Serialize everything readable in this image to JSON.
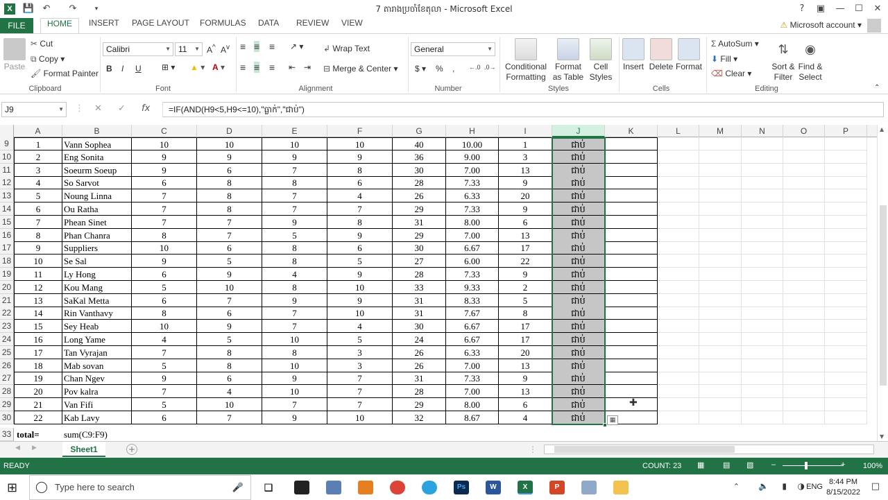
{
  "window": {
    "title": "7 តារាងប្រចាំខែតុលា - Microsoft Excel",
    "help": "?",
    "account_label": "Microsoft account"
  },
  "tabs": [
    "FILE",
    "HOME",
    "INSERT",
    "PAGE LAYOUT",
    "FORMULAS",
    "DATA",
    "REVIEW",
    "VIEW"
  ],
  "active_tab": "HOME",
  "ribbon": {
    "clipboard": {
      "label": "Clipboard",
      "paste": "Paste",
      "cut": "Cut",
      "copy": "Copy",
      "format_painter": "Format Painter"
    },
    "font": {
      "label": "Font",
      "name": "Calibri",
      "size": "11",
      "bold": "B",
      "italic": "I",
      "underline": "U"
    },
    "alignment": {
      "label": "Alignment",
      "wrap_text": "Wrap Text",
      "merge_center": "Merge & Center"
    },
    "number": {
      "label": "Number",
      "format": "General",
      "currency": "$",
      "percent": "%",
      "comma": ","
    },
    "styles": {
      "label": "Styles",
      "conditional": "Conditional Formatting",
      "format_table": "Format as Table",
      "cell_styles": "Cell Styles"
    },
    "cells": {
      "label": "Cells",
      "insert": "Insert",
      "delete": "Delete",
      "format": "Format"
    },
    "editing": {
      "label": "Editing",
      "autosum": "AutoSum",
      "fill": "Fill",
      "clear": "Clear",
      "sort_filter": "Sort & Filter",
      "find_select": "Find & Select"
    }
  },
  "formula_bar": {
    "name_box": "J9",
    "fx": "fx",
    "formula": "=IF(AND(H9<5,H9<=10),\"ធ្លាក់\",\"ជាប់\")"
  },
  "columns": [
    "A",
    "B",
    "C",
    "D",
    "E",
    "F",
    "G",
    "H",
    "I",
    "J",
    "K",
    "L",
    "M",
    "N",
    "O",
    "P"
  ],
  "selected_column": "J",
  "rows": [
    {
      "r": "9",
      "a": "1",
      "b": "Vann Sophea",
      "c": "10",
      "d": "10",
      "e": "10",
      "f": "10",
      "g": "40",
      "h": "10.00",
      "i": "1",
      "j": "ជាប់"
    },
    {
      "r": "10",
      "a": "2",
      "b": "Eng Sonita",
      "c": "9",
      "d": "9",
      "e": "9",
      "f": "9",
      "g": "36",
      "h": "9.00",
      "i": "3",
      "j": "ជាប់"
    },
    {
      "r": "11",
      "a": "3",
      "b": "Soeurm Soeup",
      "c": "9",
      "d": "6",
      "e": "7",
      "f": "8",
      "g": "30",
      "h": "7.00",
      "i": "13",
      "j": "ជាប់"
    },
    {
      "r": "12",
      "a": "4",
      "b": "So Sarvot",
      "c": "6",
      "d": "8",
      "e": "8",
      "f": "6",
      "g": "28",
      "h": "7.33",
      "i": "9",
      "j": "ជាប់"
    },
    {
      "r": "13",
      "a": "5",
      "b": "Noung Linna",
      "c": "7",
      "d": "8",
      "e": "7",
      "f": "4",
      "g": "26",
      "h": "6.33",
      "i": "20",
      "j": "ជាប់"
    },
    {
      "r": "14",
      "a": "6",
      "b": "Ou Ratha",
      "c": "7",
      "d": "8",
      "e": "7",
      "f": "7",
      "g": "29",
      "h": "7.33",
      "i": "9",
      "j": "ជាប់"
    },
    {
      "r": "15",
      "a": "7",
      "b": "Phean Sinet",
      "c": "7",
      "d": "7",
      "e": "9",
      "f": "8",
      "g": "31",
      "h": "8.00",
      "i": "6",
      "j": "ជាប់"
    },
    {
      "r": "16",
      "a": "8",
      "b": "Phan Chanra",
      "c": "8",
      "d": "7",
      "e": "5",
      "f": "9",
      "g": "29",
      "h": "7.00",
      "i": "13",
      "j": "ជាប់"
    },
    {
      "r": "17",
      "a": "9",
      "b": "Suppliers",
      "c": "10",
      "d": "6",
      "e": "8",
      "f": "6",
      "g": "30",
      "h": "6.67",
      "i": "17",
      "j": "ជាប់"
    },
    {
      "r": "18",
      "a": "10",
      "b": "Se Sal",
      "c": "9",
      "d": "5",
      "e": "8",
      "f": "5",
      "g": "27",
      "h": "6.00",
      "i": "22",
      "j": "ជាប់"
    },
    {
      "r": "19",
      "a": "11",
      "b": "Ly Hong",
      "c": "6",
      "d": "9",
      "e": "4",
      "f": "9",
      "g": "28",
      "h": "7.33",
      "i": "9",
      "j": "ជាប់"
    },
    {
      "r": "20",
      "a": "12",
      "b": "Kou Mang",
      "c": "5",
      "d": "10",
      "e": "8",
      "f": "10",
      "g": "33",
      "h": "9.33",
      "i": "2",
      "j": "ជាប់"
    },
    {
      "r": "21",
      "a": "13",
      "b": "SaKal Metta",
      "c": "6",
      "d": "7",
      "e": "9",
      "f": "9",
      "g": "31",
      "h": "8.33",
      "i": "5",
      "j": "ជាប់"
    },
    {
      "r": "22",
      "a": "14",
      "b": "Rin Vanthavy",
      "c": "8",
      "d": "6",
      "e": "7",
      "f": "10",
      "g": "31",
      "h": "7.67",
      "i": "8",
      "j": "ជាប់"
    },
    {
      "r": "23",
      "a": "15",
      "b": "Sey Heab",
      "c": "10",
      "d": "9",
      "e": "7",
      "f": "4",
      "g": "30",
      "h": "6.67",
      "i": "17",
      "j": "ជាប់"
    },
    {
      "r": "24",
      "a": "16",
      "b": "Long Yame",
      "c": "4",
      "d": "5",
      "e": "10",
      "f": "5",
      "g": "24",
      "h": "6.67",
      "i": "17",
      "j": "ជាប់"
    },
    {
      "r": "25",
      "a": "17",
      "b": "Tan Vyrajan",
      "c": "7",
      "d": "8",
      "e": "8",
      "f": "3",
      "g": "26",
      "h": "6.33",
      "i": "20",
      "j": "ជាប់"
    },
    {
      "r": "26",
      "a": "18",
      "b": "Mab sovan",
      "c": "5",
      "d": "8",
      "e": "10",
      "f": "3",
      "g": "26",
      "h": "7.00",
      "i": "13",
      "j": "ជាប់"
    },
    {
      "r": "27",
      "a": "19",
      "b": "Chan Ngev",
      "c": "9",
      "d": "6",
      "e": "9",
      "f": "7",
      "g": "31",
      "h": "7.33",
      "i": "9",
      "j": "ជាប់"
    },
    {
      "r": "28",
      "a": "20",
      "b": "Pov kalra",
      "c": "7",
      "d": "4",
      "e": "10",
      "f": "7",
      "g": "28",
      "h": "7.00",
      "i": "13",
      "j": "ជាប់"
    },
    {
      "r": "29",
      "a": "21",
      "b": "Van Fifi",
      "c": "5",
      "d": "10",
      "e": "7",
      "f": "7",
      "g": "29",
      "h": "8.00",
      "i": "6",
      "j": "ជាប់"
    },
    {
      "r": "30",
      "a": "22",
      "b": "Kab Lavy",
      "c": "6",
      "d": "7",
      "e": "9",
      "f": "10",
      "g": "32",
      "h": "8.67",
      "i": "4",
      "j": "ជាប់"
    }
  ],
  "total_row": {
    "r": "33",
    "a": "total=",
    "b": "sum(C9:F9)"
  },
  "sheet_tab": "Sheet1",
  "status": {
    "ready": "READY",
    "count": "COUNT: 23",
    "zoom": "100%"
  },
  "taskbar": {
    "search_placeholder": "Type here to search",
    "lang": "ENG",
    "time": "8:44 PM",
    "date": "8/15/2022"
  }
}
